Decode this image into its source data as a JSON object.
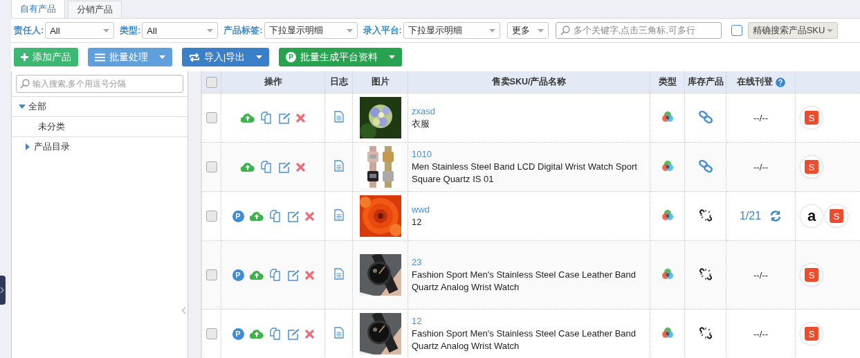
{
  "tabs": [
    {
      "label": "自有产品",
      "selected": true
    },
    {
      "label": "分销产品",
      "selected": false
    }
  ],
  "filters": [
    {
      "label": "责任人:",
      "value": "All"
    },
    {
      "label": "类型:",
      "value": "All"
    },
    {
      "label": "产品标签:",
      "value": "下拉显示明细"
    },
    {
      "label": "录入平台:",
      "value": "下拉显示明细"
    }
  ],
  "more_select": {
    "value": "更多"
  },
  "keyword_field": {
    "placeholder": "多个关键字,点击三角标,可多行"
  },
  "exact_search": {
    "checked": false,
    "value": "精确搜索产品SKU"
  },
  "toolbar": [
    {
      "kind": "plus",
      "label": "添加产品",
      "color": "#3db872",
      "dropdown": false
    },
    {
      "kind": "list",
      "label": "批量处理",
      "color": "#5fa0dc",
      "dropdown": true
    },
    {
      "kind": "exchange",
      "label": "导入|导出",
      "color": "#3a80c9",
      "dropdown": true
    },
    {
      "kind": "badge",
      "glyph": "P",
      "label": "批量生成平台资料",
      "color": "#27a350",
      "dropdown": true
    }
  ],
  "sidebar": {
    "search_placeholder": "输入搜索,多个用逗号分隔",
    "tree": [
      {
        "label": "全部",
        "expanded": true,
        "children": [
          {
            "label": "未分类"
          },
          {
            "label": "产品目录",
            "expanded": false
          }
        ]
      }
    ]
  },
  "table": {
    "select_all": {
      "checked": false
    },
    "columns": [
      "操作",
      "日志",
      "图片",
      "售卖SKU/产品名称",
      "类型",
      "库存产品",
      "在线刊登"
    ],
    "rows": [
      {
        "checked": false,
        "publish_badge": null,
        "image": {
          "kind": "picture"
        },
        "sku": "zxasd",
        "name": "衣服",
        "stock": {
          "kind": "linked"
        },
        "online": "--/--",
        "sync": false,
        "platforms": [
          {
            "kind": "shopee",
            "glyph": "S"
          }
        ]
      },
      {
        "checked": false,
        "publish_badge": null,
        "image": {
          "kind": "picture"
        },
        "sku": "1010",
        "name": "Men Stainless Steel Band LCD Digital Wrist Watch Sport Square Quartz IS 01",
        "stock": {
          "kind": "linked"
        },
        "online": "--/--",
        "sync": false,
        "platforms": [
          {
            "kind": "shopee",
            "glyph": "S"
          }
        ]
      },
      {
        "checked": false,
        "publish_badge": "P",
        "image": {
          "kind": "picture"
        },
        "sku": "wwd",
        "name": "12",
        "stock": {
          "kind": "broken"
        },
        "online": "1/21",
        "sync": true,
        "platforms": [
          {
            "kind": "amazon",
            "glyph": "a"
          },
          {
            "kind": "shopee",
            "glyph": "S"
          }
        ]
      },
      {
        "checked": false,
        "publish_badge": "P",
        "image": {
          "kind": "picture"
        },
        "sku": "23",
        "name": "Fashion Sport Men's Stainless Steel Case Leather Band Quartz Analog Wrist Watch",
        "stock": {
          "kind": "broken"
        },
        "online": "--/--",
        "sync": false,
        "platforms": [
          {
            "kind": "shopee",
            "glyph": "S"
          }
        ]
      },
      {
        "checked": false,
        "publish_badge": "P",
        "image": {
          "kind": "picture"
        },
        "sku": "12",
        "name": "Fashion Sport Men's Stainless Steel Case Leather Band Quartz Analog Wrist Watch",
        "stock": {
          "kind": "broken"
        },
        "online": "--/--",
        "sync": false,
        "platforms": [
          {
            "kind": "shopee",
            "glyph": "S"
          }
        ]
      }
    ]
  }
}
